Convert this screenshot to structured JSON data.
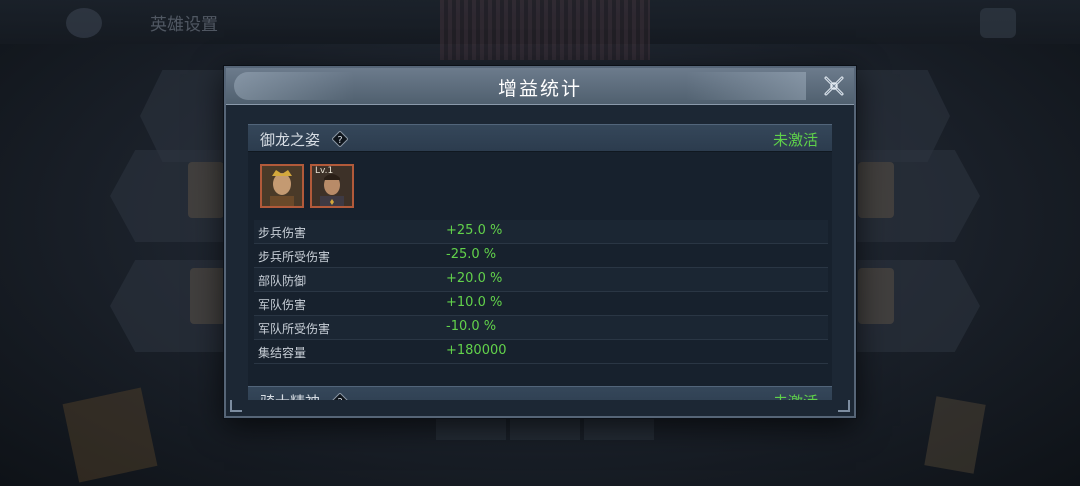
{
  "background": {
    "title": "英雄设置"
  },
  "dialog": {
    "title": "增益统计",
    "sections": [
      {
        "title": "御龙之姿",
        "status": "未激活",
        "avatars": [
          {
            "name": "hero-portrait-1",
            "level": ""
          },
          {
            "name": "hero-portrait-2",
            "level": "Lv.1"
          }
        ],
        "stats": [
          {
            "label": "步兵伤害",
            "value": "+25.0 %"
          },
          {
            "label": "步兵所受伤害",
            "value": "-25.0 %"
          },
          {
            "label": "部队防御",
            "value": "+20.0 %"
          },
          {
            "label": "军队伤害",
            "value": "+10.0 %"
          },
          {
            "label": "军队所受伤害",
            "value": "-10.0 %"
          },
          {
            "label": "集结容量",
            "value": "+180000"
          }
        ]
      },
      {
        "title": "骑士精神",
        "status": "未激活"
      }
    ]
  },
  "colors": {
    "active_green": "#5fd24a",
    "avatar_border": "#b25a3a"
  },
  "icons": {
    "help": "question-diamond-icon",
    "close": "close-x-icon"
  }
}
